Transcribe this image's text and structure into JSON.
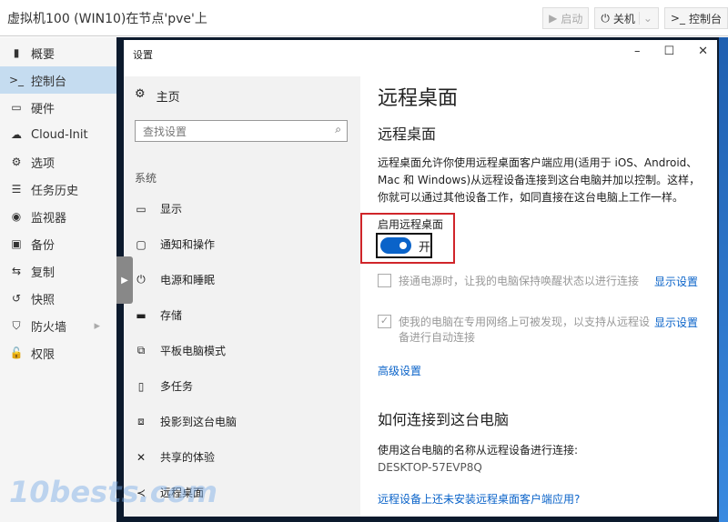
{
  "header": {
    "title": "虚拟机100 (WIN10)在节点'pve'上",
    "start": "启动",
    "shutdown": "关机",
    "console": "控制台"
  },
  "sidebar": {
    "items": [
      {
        "icon": "book-icon",
        "glyph": "▮",
        "label": "概要"
      },
      {
        "icon": "terminal-icon",
        "glyph": ">_",
        "label": "控制台"
      },
      {
        "icon": "monitor-icon",
        "glyph": "▭",
        "label": "硬件"
      },
      {
        "icon": "cloud-icon",
        "glyph": "☁",
        "label": "Cloud-Init"
      },
      {
        "icon": "gear-icon",
        "glyph": "⚙",
        "label": "选项"
      },
      {
        "icon": "list-icon",
        "glyph": "☰",
        "label": "任务历史"
      },
      {
        "icon": "eye-icon",
        "glyph": "◉",
        "label": "监视器"
      },
      {
        "icon": "floppy-icon",
        "glyph": "▣",
        "label": "备份"
      },
      {
        "icon": "retweet-icon",
        "glyph": "⇆",
        "label": "复制"
      },
      {
        "icon": "history-icon",
        "glyph": "↺",
        "label": "快照"
      },
      {
        "icon": "shield-icon",
        "glyph": "⛉",
        "label": "防火墙"
      },
      {
        "icon": "unlock-icon",
        "glyph": "🔓",
        "label": "权限"
      }
    ]
  },
  "settings": {
    "title": "设置",
    "home": "主页",
    "search_placeholder": "查找设置",
    "group": "系统",
    "nav": [
      {
        "icon": "display-icon",
        "glyph": "▭",
        "label": "显示"
      },
      {
        "icon": "notification-icon",
        "glyph": "▢",
        "label": "通知和操作"
      },
      {
        "icon": "power-icon",
        "glyph": "⏻",
        "label": "电源和睡眠"
      },
      {
        "icon": "storage-icon",
        "glyph": "▬",
        "label": "存储"
      },
      {
        "icon": "tablet-icon",
        "glyph": "⧉",
        "label": "平板电脑模式"
      },
      {
        "icon": "multitask-icon",
        "glyph": "▯",
        "label": "多任务"
      },
      {
        "icon": "project-icon",
        "glyph": "⧈",
        "label": "投影到这台电脑"
      },
      {
        "icon": "shared-icon",
        "glyph": "✕",
        "label": "共享的体验"
      },
      {
        "icon": "remote-icon",
        "glyph": "≺",
        "label": "远程桌面"
      }
    ],
    "page_title": "远程桌面",
    "section": "远程桌面",
    "description": "远程桌面允许你使用远程桌面客户端应用(适用于 iOS、Android、Mac 和 Windows)从远程设备连接到这台电脑并加以控制。这样，你就可以通过其他设备工作，如同直接在这台电脑上工作一样。",
    "toggle_label": "启用远程桌面",
    "toggle_state": "开",
    "toggle_on": true,
    "option1": {
      "label": "接通电源时，让我的电脑保持唤醒状态以进行连接",
      "checked": false,
      "link": "显示设置"
    },
    "option2": {
      "label": "使我的电脑在专用网络上可被发现，以支持从远程设备进行自动连接",
      "checked": true,
      "link": "显示设置"
    },
    "advanced": "高级设置",
    "how_title": "如何连接到这台电脑",
    "how_text": "使用这台电脑的名称从远程设备进行连接:",
    "pc_name": "DESKTOP-57EVP8Q",
    "client_link": "远程设备上还未安装远程桌面客户端应用?"
  },
  "watermark": "10bests.com"
}
